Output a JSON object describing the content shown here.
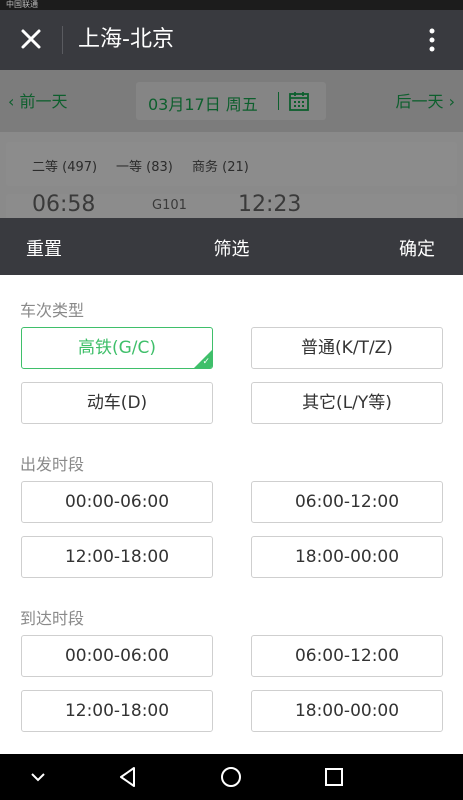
{
  "status_bar": {
    "carrier": "中国联通"
  },
  "titlebar": {
    "title": "上海-北京"
  },
  "date_bar": {
    "prev": "‹ 前一天",
    "date": "03月17日 周五",
    "next": "后一天 ›"
  },
  "seats": [
    {
      "label": "二等 (497)"
    },
    {
      "label": "一等 (83)"
    },
    {
      "label": "商务 (21)"
    }
  ],
  "train_peek": {
    "depart": "06:58",
    "arrive": "12:23",
    "code": "G101"
  },
  "filter": {
    "reset": "重置",
    "title": "筛选",
    "confirm": "确定"
  },
  "sections": {
    "train_type": {
      "label": "车次类型",
      "options": [
        "高铁(G/C)",
        "普通(K/T/Z)",
        "动车(D)",
        "其它(L/Y等)"
      ],
      "selected": "高铁(G/C)"
    },
    "depart_time": {
      "label": "出发时段",
      "options": [
        "00:00-06:00",
        "06:00-12:00",
        "12:00-18:00",
        "18:00-00:00"
      ]
    },
    "arrive_time": {
      "label": "到达时段",
      "options": [
        "00:00-06:00",
        "06:00-12:00",
        "12:00-18:00",
        "18:00-00:00"
      ]
    }
  },
  "icons": {
    "close": "close-icon",
    "more": "more-vertical-icon",
    "calendar": "calendar-icon",
    "check": "checkmark-icon",
    "nav": [
      "chevron-down-icon",
      "back-triangle-icon",
      "home-circle-icon",
      "recents-square-icon"
    ]
  },
  "colors": {
    "accent": "#3fbf6a",
    "header": "#393a3f",
    "date_green": "#0d5f2d"
  }
}
